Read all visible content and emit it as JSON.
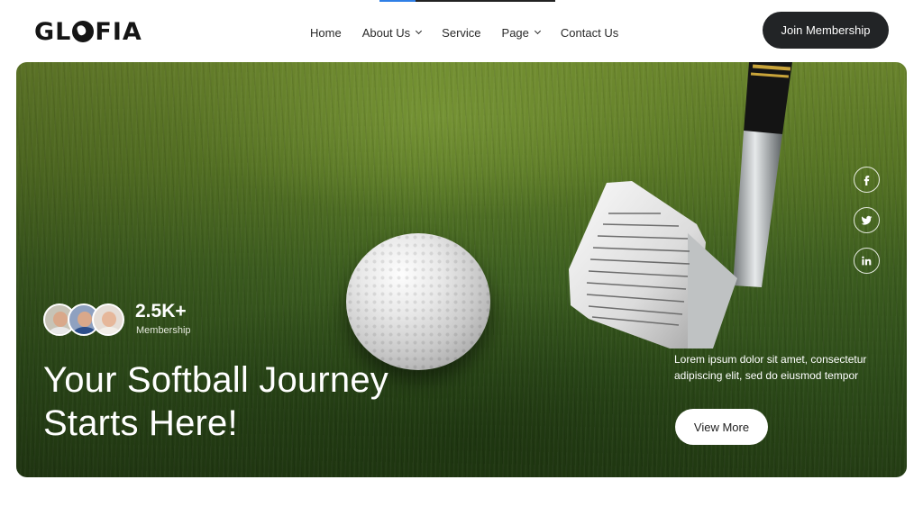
{
  "brand": {
    "logo_text_start": "GL",
    "logo_text_end": "FIA"
  },
  "nav": {
    "items": [
      {
        "label": "Home",
        "has_dropdown": false
      },
      {
        "label": "About Us",
        "has_dropdown": true
      },
      {
        "label": "Service",
        "has_dropdown": false
      },
      {
        "label": "Page",
        "has_dropdown": true
      },
      {
        "label": "Contact Us",
        "has_dropdown": false
      }
    ],
    "cta_label": "Join Membership"
  },
  "hero": {
    "stat_value": "2.5K+",
    "stat_label": "Membership",
    "title_line1": "Your Softball Journey",
    "title_line2": "Starts Here!",
    "description": "Lorem ipsum dolor sit amet, consectetur adipiscing elit, sed do eiusmod tempor",
    "button_label": "View More"
  },
  "social": [
    "facebook-icon",
    "twitter-icon",
    "linkedin-icon"
  ],
  "colors": {
    "cta_bg": "#222426",
    "hero_green": "#3f6120",
    "accent_blue": "#2f7fe6"
  }
}
